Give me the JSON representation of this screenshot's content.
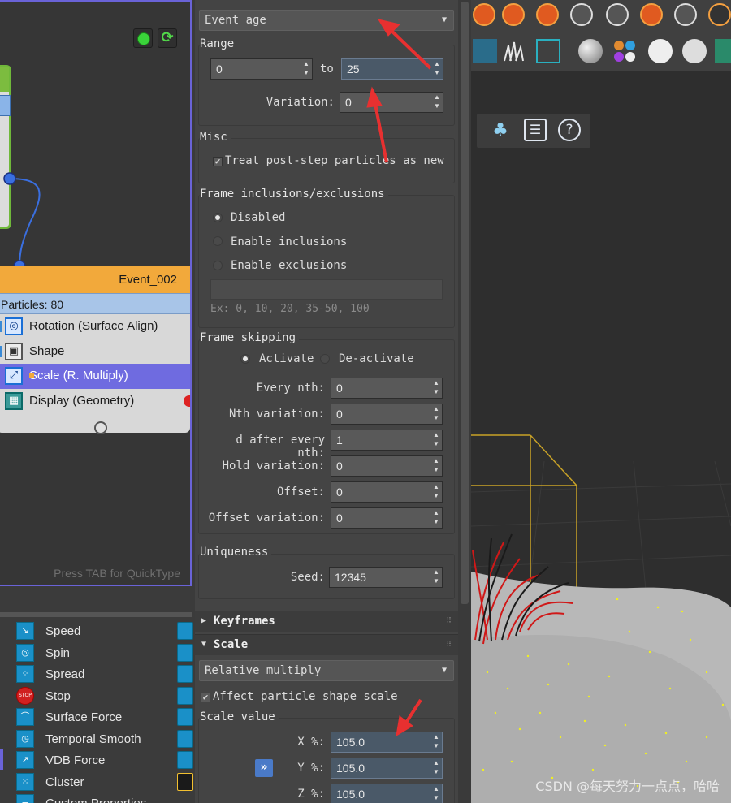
{
  "particle_view": {
    "event_node": {
      "title": "Event_002",
      "particle_count": "Particles: 80",
      "operators": [
        {
          "label": "Rotation (Surface Align)",
          "icon": "rotation-icon"
        },
        {
          "label": "Shape",
          "icon": "shape-cube-icon"
        },
        {
          "label": "Scale (R. Multiply)",
          "icon": "scale-icon"
        },
        {
          "label": "Display (Geometry)",
          "icon": "display-icon"
        }
      ]
    },
    "quicktype_hint": "Press TAB for QuickType",
    "depot": [
      {
        "label": "Speed",
        "icon": "speed-icon"
      },
      {
        "label": "Spin",
        "icon": "spin-icon"
      },
      {
        "label": "Spread",
        "icon": "spread-icon"
      },
      {
        "label": "Stop",
        "icon": "stop-icon",
        "badge": "STOP"
      },
      {
        "label": "Surface Force",
        "icon": "surface-force-icon"
      },
      {
        "label": "Temporal Smooth",
        "icon": "temporal-smooth-icon"
      },
      {
        "label": "VDB Force",
        "icon": "vdb-force-icon"
      },
      {
        "label": "Cluster",
        "icon": "cluster-icon"
      },
      {
        "label": "Custom Properties",
        "icon": "custom-properties-icon"
      }
    ]
  },
  "panel": {
    "mode_dropdown": "Event age",
    "range": {
      "title": "Range",
      "from": "0",
      "to_label": "to",
      "to": "25",
      "variation_label": "Variation:",
      "variation": "0"
    },
    "misc": {
      "title": "Misc",
      "treat_post_step": "Treat post-step particles as new",
      "treat_post_step_checked": true
    },
    "frame_inclusions": {
      "title": "Frame inclusions/exclusions",
      "options": [
        "Disabled",
        "Enable inclusions",
        "Enable exclusions"
      ],
      "selected": "Disabled",
      "hint": "Ex: 0, 10, 20, 35-50, 100"
    },
    "frame_skipping": {
      "title": "Frame skipping",
      "activate": "Activate",
      "deactivate": "De-activate",
      "selected": "Activate",
      "fields": [
        {
          "label": "Every nth:",
          "value": "0"
        },
        {
          "label": "Nth variation:",
          "value": "0"
        },
        {
          "label": "d after every nth:",
          "value": "1"
        },
        {
          "label": "Hold variation:",
          "value": "0"
        },
        {
          "label": "Offset:",
          "value": "0"
        },
        {
          "label": "Offset variation:",
          "value": "0"
        }
      ]
    },
    "uniqueness": {
      "title": "Uniqueness",
      "seed_label": "Seed:",
      "seed": "12345"
    },
    "rollouts": {
      "keyframes": "Keyframes",
      "scale": "Scale"
    },
    "scale": {
      "mode": "Relative multiply",
      "affect_shape": "Affect particle shape scale",
      "affect_checked": true,
      "scale_value_title": "Scale value",
      "x_label": "X %:",
      "x": "105.0",
      "y_label": "Y %:",
      "y": "105.0",
      "z_label": "Z %:",
      "z": "105.0",
      "link_button": "»"
    }
  },
  "viewport": {
    "floating_tools": [
      "tree-icon",
      "list-icon",
      "help-icon"
    ],
    "help_glyph": "?",
    "watermark": "CSDN @每天努力一点点，哈哈"
  },
  "colors": {
    "selection": "#6f6be0",
    "event_header": "#f2a93b",
    "annotation_arrow": "#e83030",
    "bounding_box": "#c9a227",
    "grass": "#d01818"
  }
}
